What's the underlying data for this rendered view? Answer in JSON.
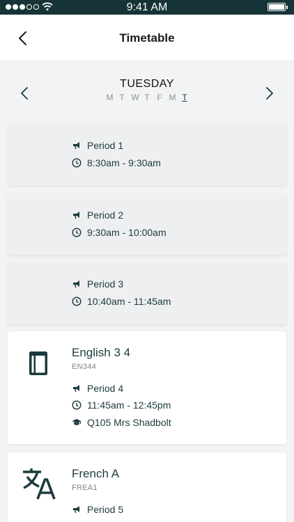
{
  "status_bar": {
    "time": "9:41 AM"
  },
  "header": {
    "title": "Timetable"
  },
  "day_nav": {
    "day": "TUESDAY",
    "weekdays": [
      "M",
      "T",
      "W",
      "T",
      "F",
      "M",
      "T"
    ],
    "active_index": 6
  },
  "periods": [
    {
      "period": "Period 1",
      "time": "8:30am - 9:30am"
    },
    {
      "period": "Period 2",
      "time": "9:30am - 10:00am"
    },
    {
      "period": "Period 3",
      "time": "10:40am - 11:45am"
    },
    {
      "subject": "English 3 4",
      "code": "EN344",
      "period": "Period 4",
      "time": "11:45am - 12:45pm",
      "room": "Q105 Mrs Shadbolt",
      "icon": "book-icon"
    },
    {
      "subject": "French A",
      "code": "FREA1",
      "period": "Period 5",
      "icon": "translate-icon"
    }
  ],
  "colors": {
    "status_bar": "#163437",
    "accent": "#1c3a3d",
    "background": "#f2f3f4"
  }
}
